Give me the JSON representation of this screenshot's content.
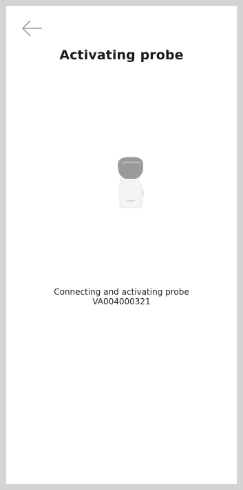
{
  "header": {
    "back_icon": "arrow-left-icon",
    "title": "Activating probe"
  },
  "illustration": {
    "icon": "ultrasound-probe-icon",
    "head_color": "#9a9a9a",
    "body_color": "#f3f3f3"
  },
  "status": {
    "message": "Connecting and activating probe",
    "probe_id": "VA004000321"
  },
  "colors": {
    "frame": "#d4d4d4",
    "screen": "#ffffff",
    "text": "#1a1a1a"
  }
}
